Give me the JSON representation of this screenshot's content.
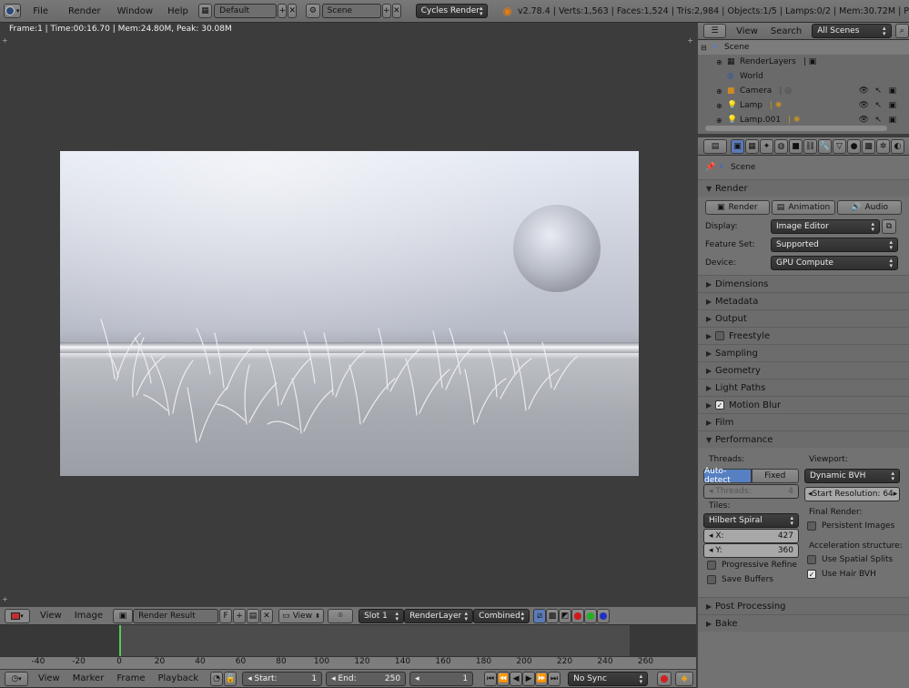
{
  "topbar": {
    "menus": [
      "File",
      "Render",
      "Window",
      "Help"
    ],
    "screen_layout": "Default",
    "scene": "Scene",
    "engine": "Cycles Render",
    "stats": "v2.78.4 | Verts:1,563 | Faces:1,524 | Tris:2,984 | Objects:1/5 | Lamps:0/2 | Mem:30.72M | P"
  },
  "render_view": {
    "status": "Frame:1 | Time:00:16.70 | Mem:24.80M, Peak: 30.08M"
  },
  "image_editor_header": {
    "view": "View",
    "image": "Image",
    "image_name": "Render Result",
    "fake_user": "F",
    "view_dd": "View",
    "slot": "Slot 1",
    "layer": "RenderLayer",
    "pass": "Combined"
  },
  "timeline": {
    "ticks": [
      "-40",
      "-20",
      "0",
      "20",
      "40",
      "60",
      "80",
      "100",
      "120",
      "140",
      "160",
      "180",
      "200",
      "220",
      "240",
      "260"
    ],
    "current_frame_marker": 0
  },
  "timeline_header": {
    "menus": [
      "View",
      "Marker",
      "Frame",
      "Playback"
    ],
    "start_label": "Start:",
    "start_value": "1",
    "end_label": "End:",
    "end_value": "250",
    "current": "1",
    "sync": "No Sync"
  },
  "outliner": {
    "view": "View",
    "search": "Search",
    "filter": "All Scenes",
    "items": [
      {
        "label": "Scene"
      },
      {
        "label": "RenderLayers"
      },
      {
        "label": "World"
      },
      {
        "label": "Camera"
      },
      {
        "label": "Lamp"
      },
      {
        "label": "Lamp.001"
      }
    ]
  },
  "properties": {
    "context": "Scene",
    "render": {
      "title": "Render",
      "buttons": [
        "Render",
        "Animation",
        "Audio"
      ],
      "display_label": "Display:",
      "display_value": "Image Editor",
      "feature_label": "Feature Set:",
      "feature_value": "Supported",
      "device_label": "Device:",
      "device_value": "GPU Compute"
    },
    "panels": [
      "Dimensions",
      "Metadata",
      "Output",
      "Freestyle",
      "Sampling",
      "Geometry",
      "Light Paths",
      "Motion Blur",
      "Film",
      "Performance"
    ],
    "performance": {
      "threads_label": "Threads:",
      "auto_detect": "Auto-detect",
      "fixed": "Fixed",
      "threads_field_label": "Threads:",
      "threads_field_value": "4",
      "tiles_label": "Tiles:",
      "tiles_value": "Hilbert Spiral",
      "x_label": "X:",
      "x_value": "427",
      "y_label": "Y:",
      "y_value": "360",
      "progressive": "Progressive Refine",
      "save_buffers": "Save Buffers",
      "viewport_label": "Viewport:",
      "viewport_value": "Dynamic BVH",
      "start_res_label": "Start Resolution:",
      "start_res_value": "64",
      "final_label": "Final Render:",
      "persistent": "Persistent Images",
      "accel_label": "Acceleration structure:",
      "spatial": "Use Spatial Splits",
      "hair_bvh": "Use Hair BVH"
    },
    "post_processing": "Post Processing",
    "bake": "Bake"
  }
}
